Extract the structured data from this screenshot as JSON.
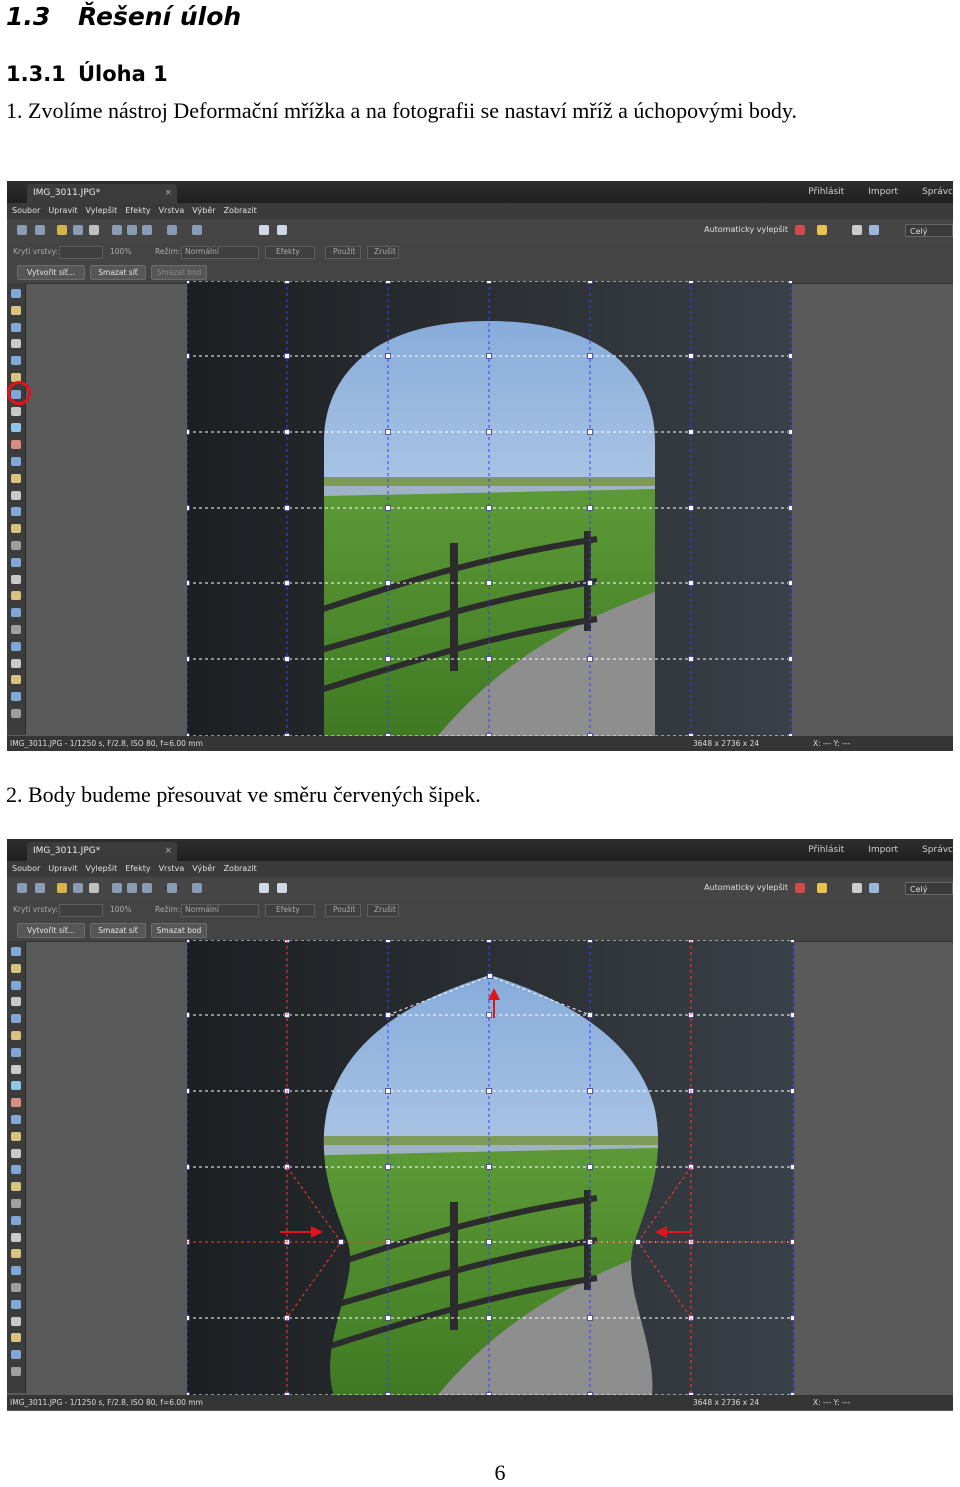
{
  "heading": {
    "number": "1.3",
    "title": "Řešení úloh"
  },
  "subheading": {
    "number": "1.3.1",
    "title": "Úloha 1"
  },
  "step1": "1. Zvolíme nástroj Deformační mřížka a na fotografii se nastaví mříž a úchopovými body.",
  "step2": "2. Body budeme přesouvat ve směru červených šipek.",
  "page_number": "6",
  "editor": {
    "tab_title": "IMG_3011.JPG*",
    "tab_close": "×",
    "top_links": [
      "Přihlásit",
      "Import",
      "Správc"
    ],
    "menu": [
      "Soubor",
      "Upravit",
      "Vylepšit",
      "Efekty",
      "Vrstva",
      "Výběr",
      "Zobrazit"
    ],
    "autofix_label": "Automaticky vylepšit",
    "view_select": "Celý",
    "options": {
      "opacity_label": "Krytí vrstvy:",
      "opacity_value": "100%",
      "mode_label": "Režim:",
      "mode_value": "Normální",
      "effects": "Efekty",
      "apply": "Použít",
      "cancel": "Zrušit"
    },
    "grid_buttons": [
      "Vytvořit síť...",
      "Smazat síť",
      "Smazat bod"
    ],
    "status_left": "IMG_3011.JPG - 1/1250 s, F/2.8, ISO 80, f=6.00 mm",
    "status_size": "3648 x 2736 x 24",
    "status_xy": "X: ---  Y: ---",
    "colors": {
      "grid": "#3c3cff",
      "warp_grid": "#ff3b30",
      "arrow": "#e0141a",
      "highlight": "#e0141a"
    }
  }
}
